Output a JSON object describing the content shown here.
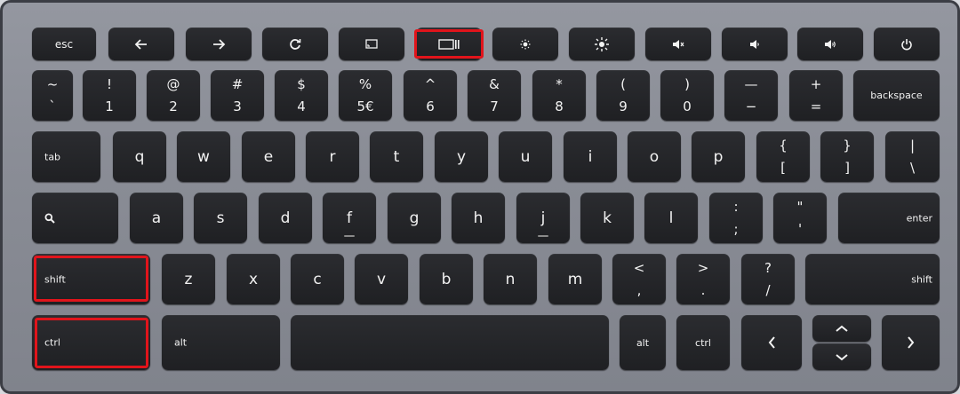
{
  "colors": {
    "highlight": "#e1141b",
    "key": "#232427",
    "frame": "#8c8f98",
    "legend": "#f2f2f2"
  },
  "row_fn": {
    "esc": "esc",
    "back_icon": "arrow-left-icon",
    "forward_icon": "arrow-right-icon",
    "refresh_icon": "refresh-icon",
    "fullscreen_icon": "fullscreen-icon",
    "overview_icon": "window-overview-icon",
    "bright_down_icon": "brightness-down-icon",
    "bright_up_icon": "brightness-up-icon",
    "mute_icon": "volume-mute-icon",
    "vol_down_icon": "volume-down-icon",
    "vol_up_icon": "volume-up-icon",
    "power_icon": "power-icon"
  },
  "row_num": {
    "tilde_up": "~",
    "tilde_dn": "`",
    "k1_up": "!",
    "k1_dn": "1",
    "k2_up": "@",
    "k2_dn": "2",
    "k3_up": "#",
    "k3_dn": "3",
    "k4_up": "$",
    "k4_dn": "4",
    "k5_up": "%",
    "k5_dn": "5€",
    "k6_up": "^",
    "k6_dn": "6",
    "k7_up": "&",
    "k7_dn": "7",
    "k8_up": "*",
    "k8_dn": "8",
    "k9_up": "(",
    "k9_dn": "9",
    "k0_up": ")",
    "k0_dn": "0",
    "minus_up": "—",
    "minus_dn": "−",
    "plus_up": "+",
    "plus_dn": "=",
    "backspace": "backspace"
  },
  "row_q": {
    "tab": "tab",
    "q": "q",
    "w": "w",
    "e": "e",
    "r": "r",
    "t": "t",
    "y": "y",
    "u": "u",
    "i": "i",
    "o": "o",
    "p": "p",
    "lbrace_up": "{",
    "lbrace_dn": "[",
    "rbrace_up": "}",
    "rbrace_dn": "]",
    "pipe_up": "|",
    "pipe_dn": "\\"
  },
  "row_a": {
    "search_icon": "search-icon",
    "a": "a",
    "s": "s",
    "d": "d",
    "f": "f",
    "g": "g",
    "h": "h",
    "j": "j",
    "k": "k",
    "l": "l",
    "colon_up": ":",
    "colon_dn": ";",
    "quote_up": "\"",
    "quote_dn": "'",
    "enter": "enter"
  },
  "row_z": {
    "shift_left": "shift",
    "z": "z",
    "x": "x",
    "c": "c",
    "v": "v",
    "b": "b",
    "n": "n",
    "m": "m",
    "lt_up": "<",
    "lt_dn": ",",
    "gt_up": ">",
    "gt_dn": ".",
    "q_up": "?",
    "q_dn": "/",
    "shift_right": "shift"
  },
  "row_bottom": {
    "ctrl_left": "ctrl",
    "alt_left": "alt",
    "alt_right": "alt",
    "ctrl_right": "ctrl",
    "left_icon": "chevron-left-icon",
    "up_icon": "chevron-up-icon",
    "down_icon": "chevron-down-icon",
    "right_icon": "chevron-right-icon"
  }
}
